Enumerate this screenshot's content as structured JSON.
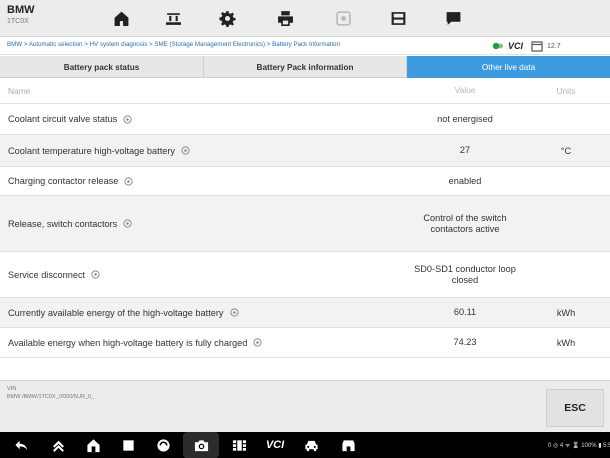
{
  "vehicle": {
    "make": "BMW",
    "model": "1TC0X"
  },
  "toolbar": {
    "buttons": [
      {
        "name": "home",
        "icon": "home-icon"
      },
      {
        "name": "vehicle-swap",
        "icon": "car-lift-icon"
      },
      {
        "name": "settings",
        "icon": "gear-icon"
      },
      {
        "name": "print",
        "icon": "printer-icon"
      },
      {
        "name": "help",
        "icon": "help-icon",
        "disabled": true
      },
      {
        "name": "save",
        "icon": "save-icon"
      },
      {
        "name": "data-logging",
        "icon": "message-icon"
      }
    ]
  },
  "breadcrumb": "BMW > Automatic selection > HV system diagnosis > SME (Storage Management Electronics) > Battery Pack Information",
  "status": {
    "vci_label": "VCI",
    "date": "12.7"
  },
  "tabs": [
    {
      "label": "Battery pack status",
      "active": false
    },
    {
      "label": "Battery Pack information",
      "active": false
    },
    {
      "label": "Other live data",
      "active": true
    }
  ],
  "table": {
    "headers": {
      "name": "Name",
      "value": "Value",
      "units": "Units"
    },
    "rows": [
      {
        "name": "Coolant circuit valve status",
        "value": "not energised",
        "units": ""
      },
      {
        "name": "Coolant temperature high-voltage battery",
        "value": "27",
        "units": "°C"
      },
      {
        "name": "Charging contactor release",
        "value": "enabled",
        "units": ""
      },
      {
        "name": "Release, switch contactors",
        "value": "Control of the switch contactors active",
        "units": ""
      },
      {
        "name": "Service disconnect",
        "value": "SD0-SD1 conductor loop closed",
        "units": ""
      },
      {
        "name": "Currently available energy of the high-voltage battery",
        "value": "60.11",
        "units": "kWh"
      },
      {
        "name": "Available energy when high-voltage battery is fully charged",
        "value": "74.23",
        "units": "kWh"
      }
    ]
  },
  "footer": {
    "vin_label": "VIN",
    "vin_path": "BMW /BMW/1TC0X_/2000/5UR_0_",
    "esc_label": "ESC"
  },
  "navbar": {
    "vci_label": "VCI",
    "system_status": "0 ◎ 4 ᯤ ⌛ 100% ▮ 5:55"
  },
  "colors": {
    "accent": "#3f9be0",
    "vci_green": "#1f9e3f",
    "link": "#2a6fb0"
  }
}
